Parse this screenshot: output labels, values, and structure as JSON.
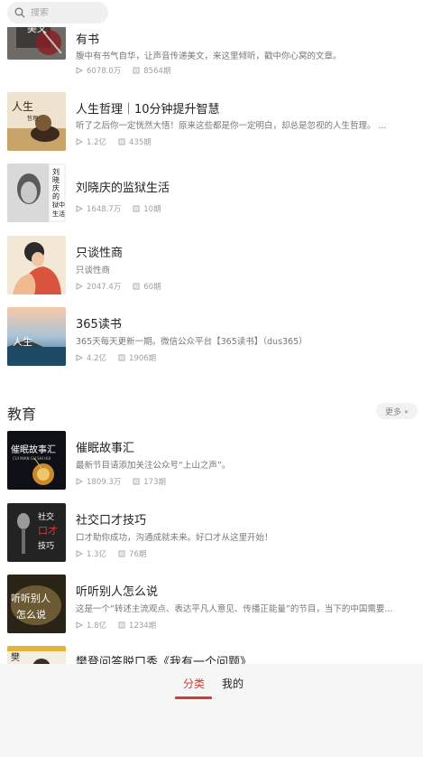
{
  "search": {
    "placeholder": "搜索"
  },
  "items_top": [
    {
      "title": "有书",
      "desc": "腹中有书气自华，让声音传递美文，来这里倾听，戳中你心窝的文章。",
      "plays": "6078.0万",
      "episodes": "8564期",
      "cover_text": "美文"
    },
    {
      "title": "人生哲理｜10分钟提升智慧",
      "desc": "听了之后你一定恍然大悟！原来这些都是你一定明白，却总是忽视的人生哲理。 ...",
      "plays": "1.2亿",
      "episodes": "435期",
      "cover_text": "人生哲理"
    },
    {
      "title": "刘晓庆的监狱生活",
      "desc": "",
      "plays": "1648.7万",
      "episodes": "10期",
      "cover_text": "刘晓庆的狱中生活"
    },
    {
      "title": "只谈性商",
      "desc": "只谈性商",
      "plays": "2047.4万",
      "episodes": "60期",
      "cover_text": ""
    },
    {
      "title": "365读书",
      "desc": "365天每天更新一期。微信公众平台【365读书】（dus365）",
      "plays": "4.2亿",
      "episodes": "1906期",
      "cover_text": "人生"
    }
  ],
  "section": {
    "title": "教育",
    "more_label": "更多"
  },
  "items_edu": [
    {
      "title": "催眠故事汇",
      "desc": "最新节目请添加关注公众号“上山之声”。",
      "plays": "1809.3万",
      "episodes": "173期",
      "cover_text": "催眠故事汇"
    },
    {
      "title": "社交口才技巧",
      "desc": "口才助你成功，沟通成就未来。好口才从这里开始！",
      "plays": "1.3亿",
      "episodes": "76期",
      "cover_text": "社交口才技巧"
    },
    {
      "title": "听听别人怎么说",
      "desc": "这是一个“转述主流观点、表达平凡人意见、传播正能量”的节目，当下的中国需要...",
      "plays": "1.8亿",
      "episodes": "1234期",
      "cover_text": "听听别人怎么说"
    },
    {
      "title": "樊登问答脱口秀《我有一个问题》",
      "desc": "",
      "plays": "",
      "episodes": "",
      "cover_text": "樊"
    }
  ],
  "bottom_nav": {
    "tab_category": "分类",
    "tab_mine": "我的"
  },
  "colors": {
    "accent": "#d43c33",
    "nav_bg": "#f6f6f6",
    "search_bg": "#f0f0f0"
  }
}
